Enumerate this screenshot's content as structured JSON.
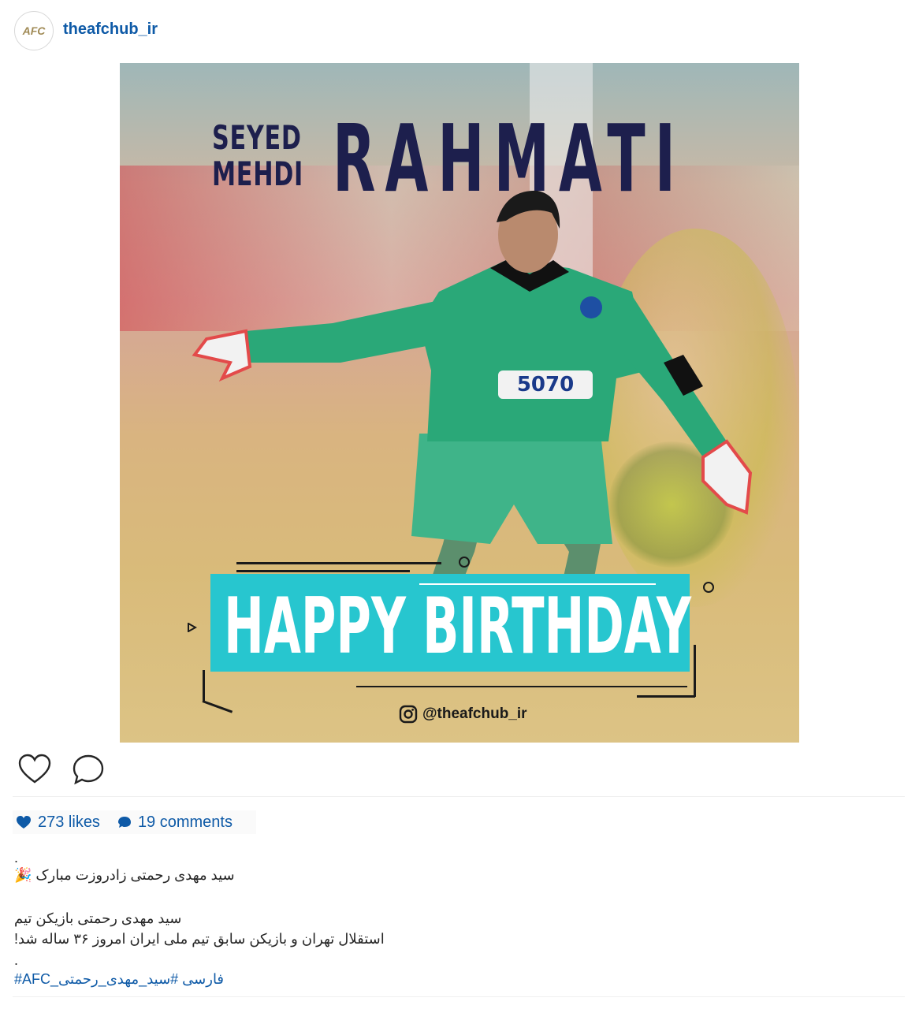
{
  "header": {
    "avatar_text": "AFC",
    "username": "theafchub_ir"
  },
  "image": {
    "name_first": "SEYED",
    "name_middle": "MEHDI",
    "name_last": "RAHMATI",
    "banner": "HAPPY BIRTHDAY",
    "handle": "@theafchub_ir",
    "jersey_number": "5070"
  },
  "stats": {
    "likes": "273 likes",
    "comments": "19 comments"
  },
  "caption": {
    "dot1": ".",
    "line1": "سید مهدی رحمتی زادروزت مبارک 🎉",
    "line2": "سید مهدی رحمتی بازیکن تیم",
    "line3": "استقلال تهران و بازیکن سابق تیم ملی ایران امروز ۳۶ ساله شد!",
    "dot2": ".",
    "hashtags": "#AFC_فارسی #سید_مهدی_رحمتی"
  },
  "colors": {
    "link": "#0e5aa7",
    "banner": "#27c6cf",
    "name": "#1d1f4d",
    "jersey": "#2aa878"
  },
  "icons": [
    "heart-icon",
    "comment-icon",
    "heart-small-icon",
    "comment-small-icon",
    "instagram-icon"
  ]
}
